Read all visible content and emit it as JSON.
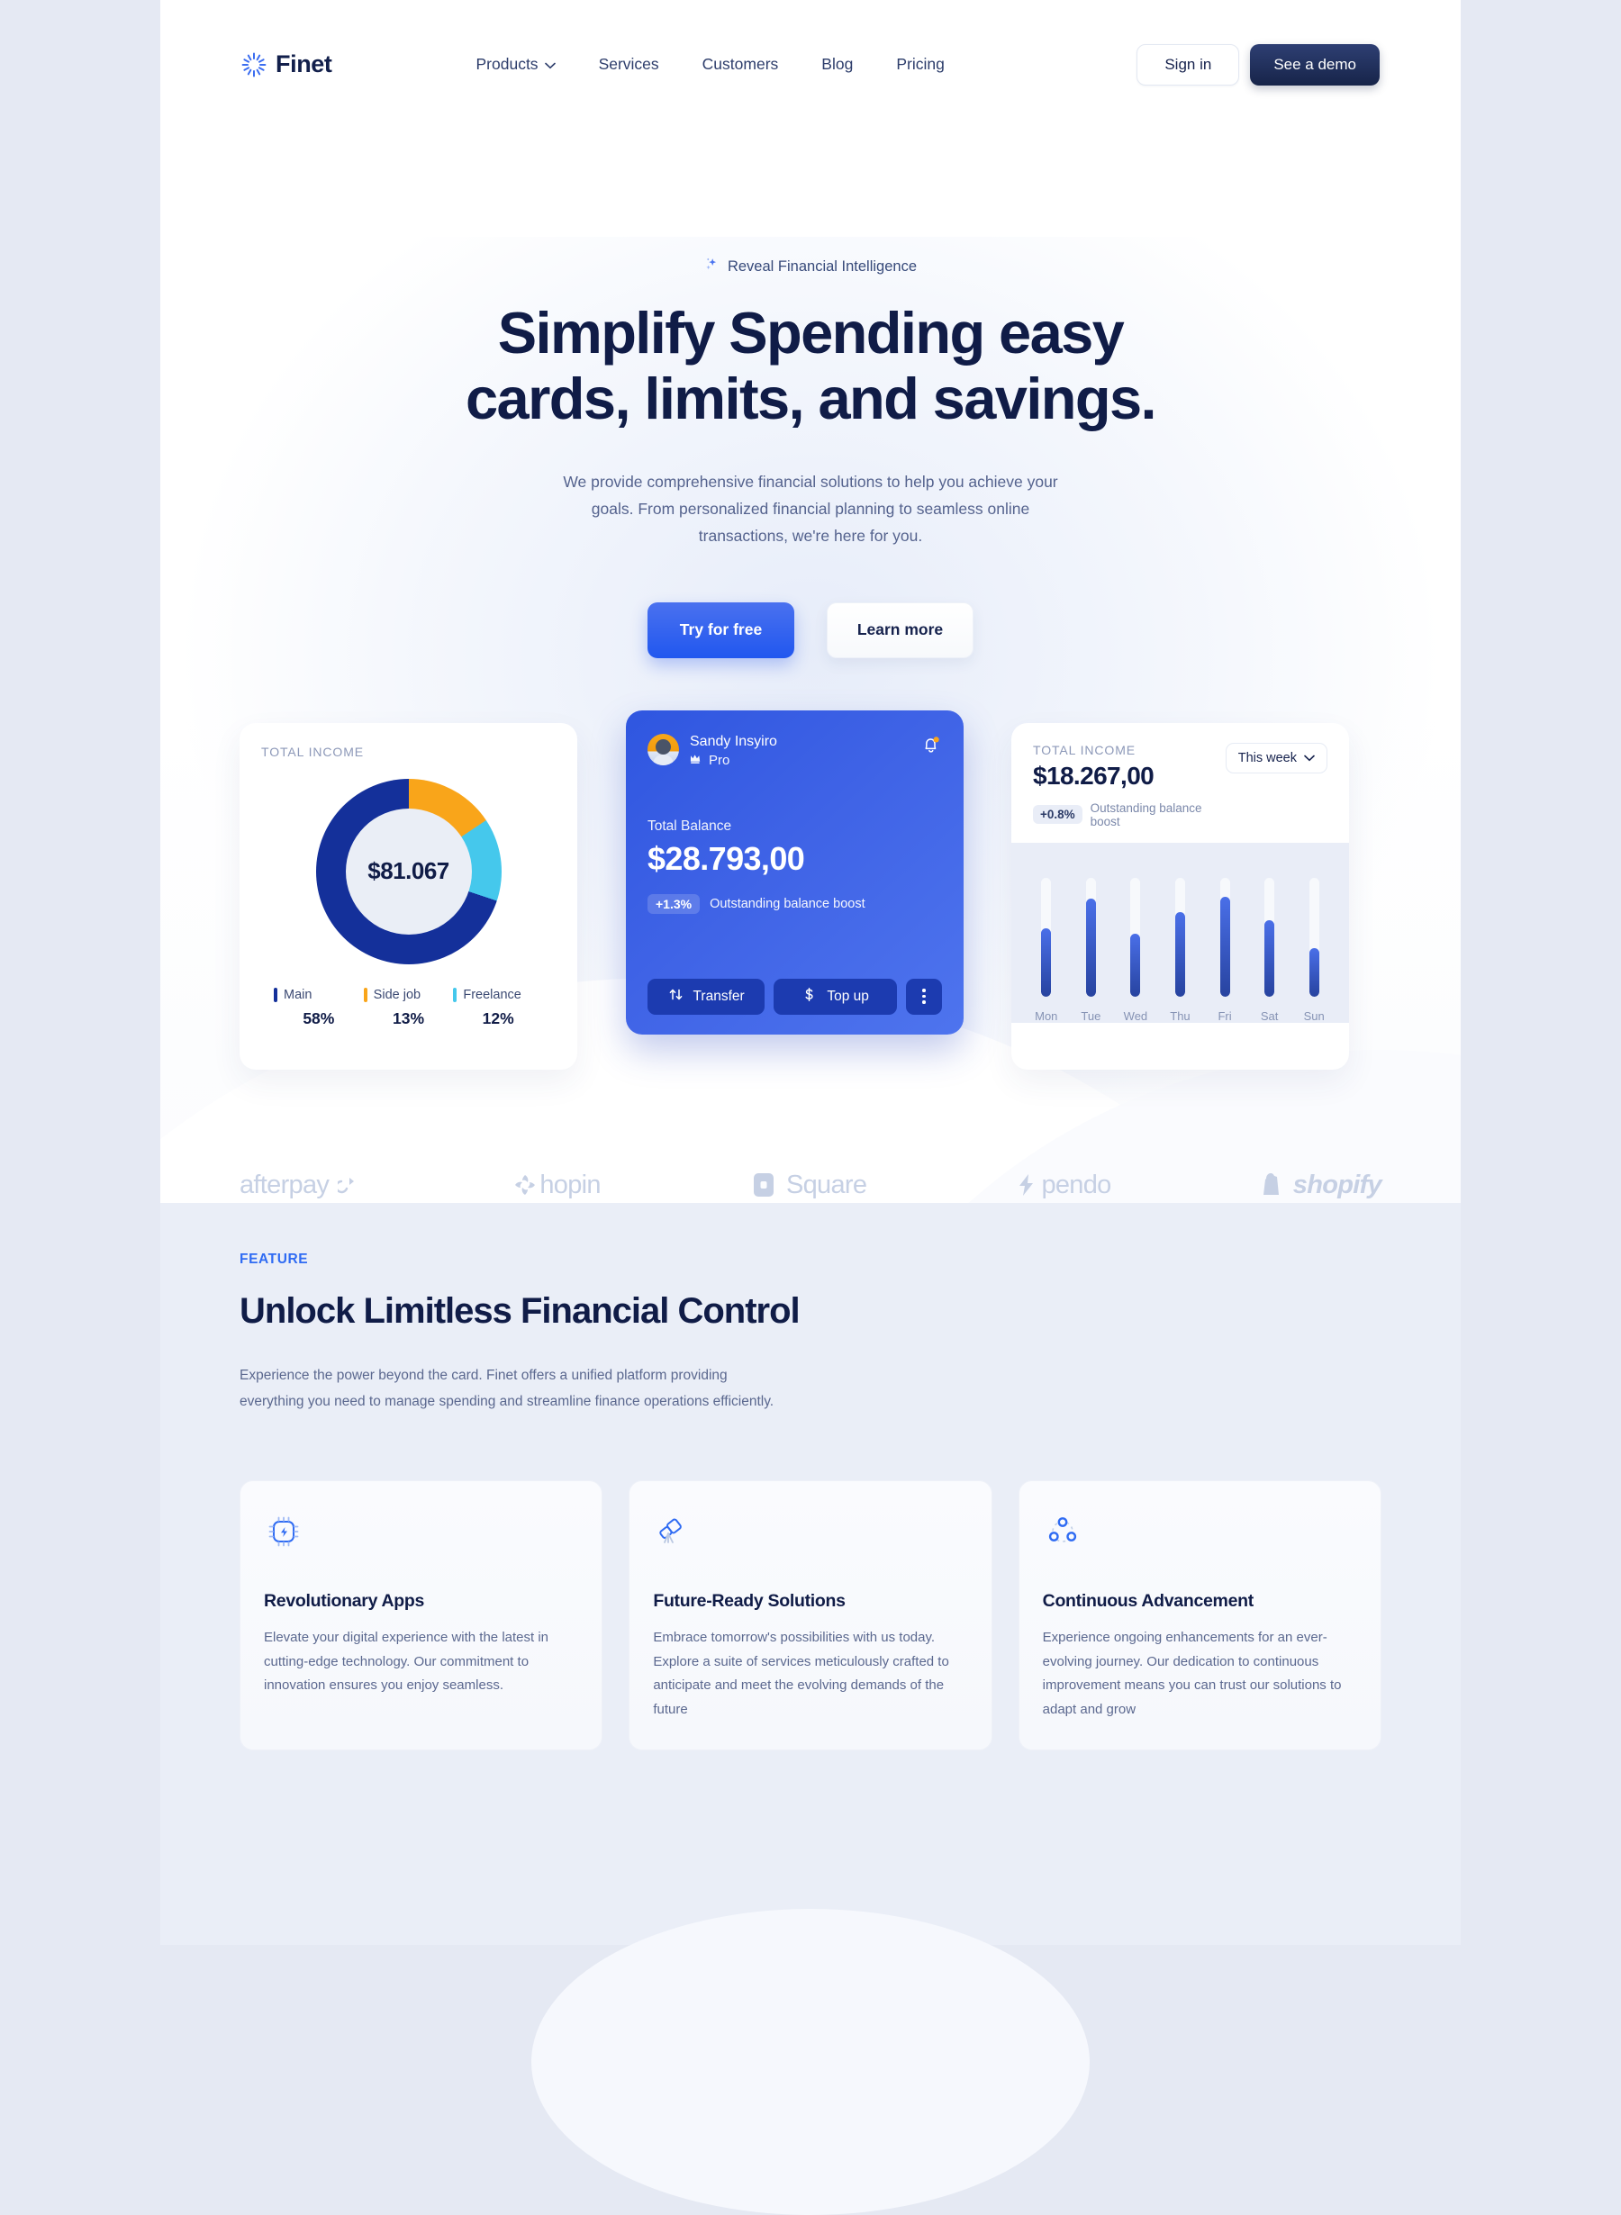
{
  "nav": {
    "brand": "Finet",
    "links": [
      {
        "label": "Products",
        "has_caret": true
      },
      {
        "label": "Services",
        "has_caret": false
      },
      {
        "label": "Customers",
        "has_caret": false
      },
      {
        "label": "Blog",
        "has_caret": false
      },
      {
        "label": "Pricing",
        "has_caret": false
      }
    ],
    "sign_in": "Sign in",
    "demo": "See a demo"
  },
  "hero": {
    "eyebrow": "Reveal Financial Intelligence",
    "title_line1": "Simplify Spending easy",
    "title_line2": "cards, limits, and savings.",
    "subtitle": "We provide comprehensive financial solutions to help you achieve your goals. From personalized financial planning to seamless online transactions, we're here for you.",
    "cta_primary": "Try for free",
    "cta_secondary": "Learn more"
  },
  "donut_card": {
    "label": "TOTAL INCOME",
    "center_value": "$81.067",
    "legend": [
      {
        "name": "Main",
        "pct": "58%",
        "color": "#14309a"
      },
      {
        "name": "Side job",
        "pct": "13%",
        "color": "#f9a51a"
      },
      {
        "name": "Freelance",
        "pct": "12%",
        "color": "#45c8ec"
      }
    ]
  },
  "balance_card": {
    "user_name": "Sandy Insyiro",
    "plan": "Pro",
    "balance_label": "Total Balance",
    "balance_amount": "$28.793,00",
    "boost_pct": "+1.3%",
    "boost_text": "Outstanding balance boost",
    "action_transfer": "Transfer",
    "action_topup": "Top up"
  },
  "bars_card": {
    "label": "TOTAL INCOME",
    "amount": "$18.267,00",
    "boost_pct": "+0.8%",
    "boost_text": "Outstanding balance boost",
    "range_selected": "This week"
  },
  "logos": [
    {
      "name": "afterpay"
    },
    {
      "name": "hopin"
    },
    {
      "name": "Square"
    },
    {
      "name": "pendo"
    },
    {
      "name": "shopify"
    }
  ],
  "feature": {
    "eyebrow": "FEATURE",
    "title": "Unlock Limitless Financial Control",
    "description": "Experience the power beyond the card. Finet offers a unified platform providing everything you need to manage spending and streamline finance operations efficiently.",
    "cards": [
      {
        "icon": "chip-bolt-icon",
        "title": "Revolutionary Apps",
        "body": "Elevate your digital experience with the latest in cutting-edge technology. Our commitment to innovation ensures you enjoy seamless."
      },
      {
        "icon": "telescope-icon",
        "title": "Future-Ready Solutions",
        "body": "Embrace tomorrow's possibilities with us today. Explore a suite of services meticulously crafted to anticipate and meet the evolving demands of the future"
      },
      {
        "icon": "network-nodes-icon",
        "title": "Continuous Advancement",
        "body": "Experience ongoing enhancements for an ever-evolving journey. Our dedication to continuous improvement means you can trust our solutions to adapt and grow"
      }
    ]
  },
  "chart_data": [
    {
      "type": "pie",
      "title": "TOTAL INCOME",
      "center_label": "$81.067",
      "categories": [
        "Main",
        "Side job",
        "Freelance"
      ],
      "values": [
        58,
        13,
        12
      ],
      "colors": [
        "#14309a",
        "#f9a51a",
        "#45c8ec"
      ],
      "legend": "bottom",
      "donut": true
    },
    {
      "type": "bar",
      "title": "TOTAL INCOME",
      "subtitle": "$18.267,00",
      "categories": [
        "Mon",
        "Tue",
        "Wed",
        "Thu",
        "Fri",
        "Sat",
        "Sun"
      ],
      "values": [
        57,
        82,
        53,
        71,
        84,
        64,
        41
      ],
      "ylim": [
        0,
        100
      ],
      "xlabel": "",
      "ylabel": "",
      "grid": false,
      "legend": "none",
      "range": "This week"
    }
  ]
}
